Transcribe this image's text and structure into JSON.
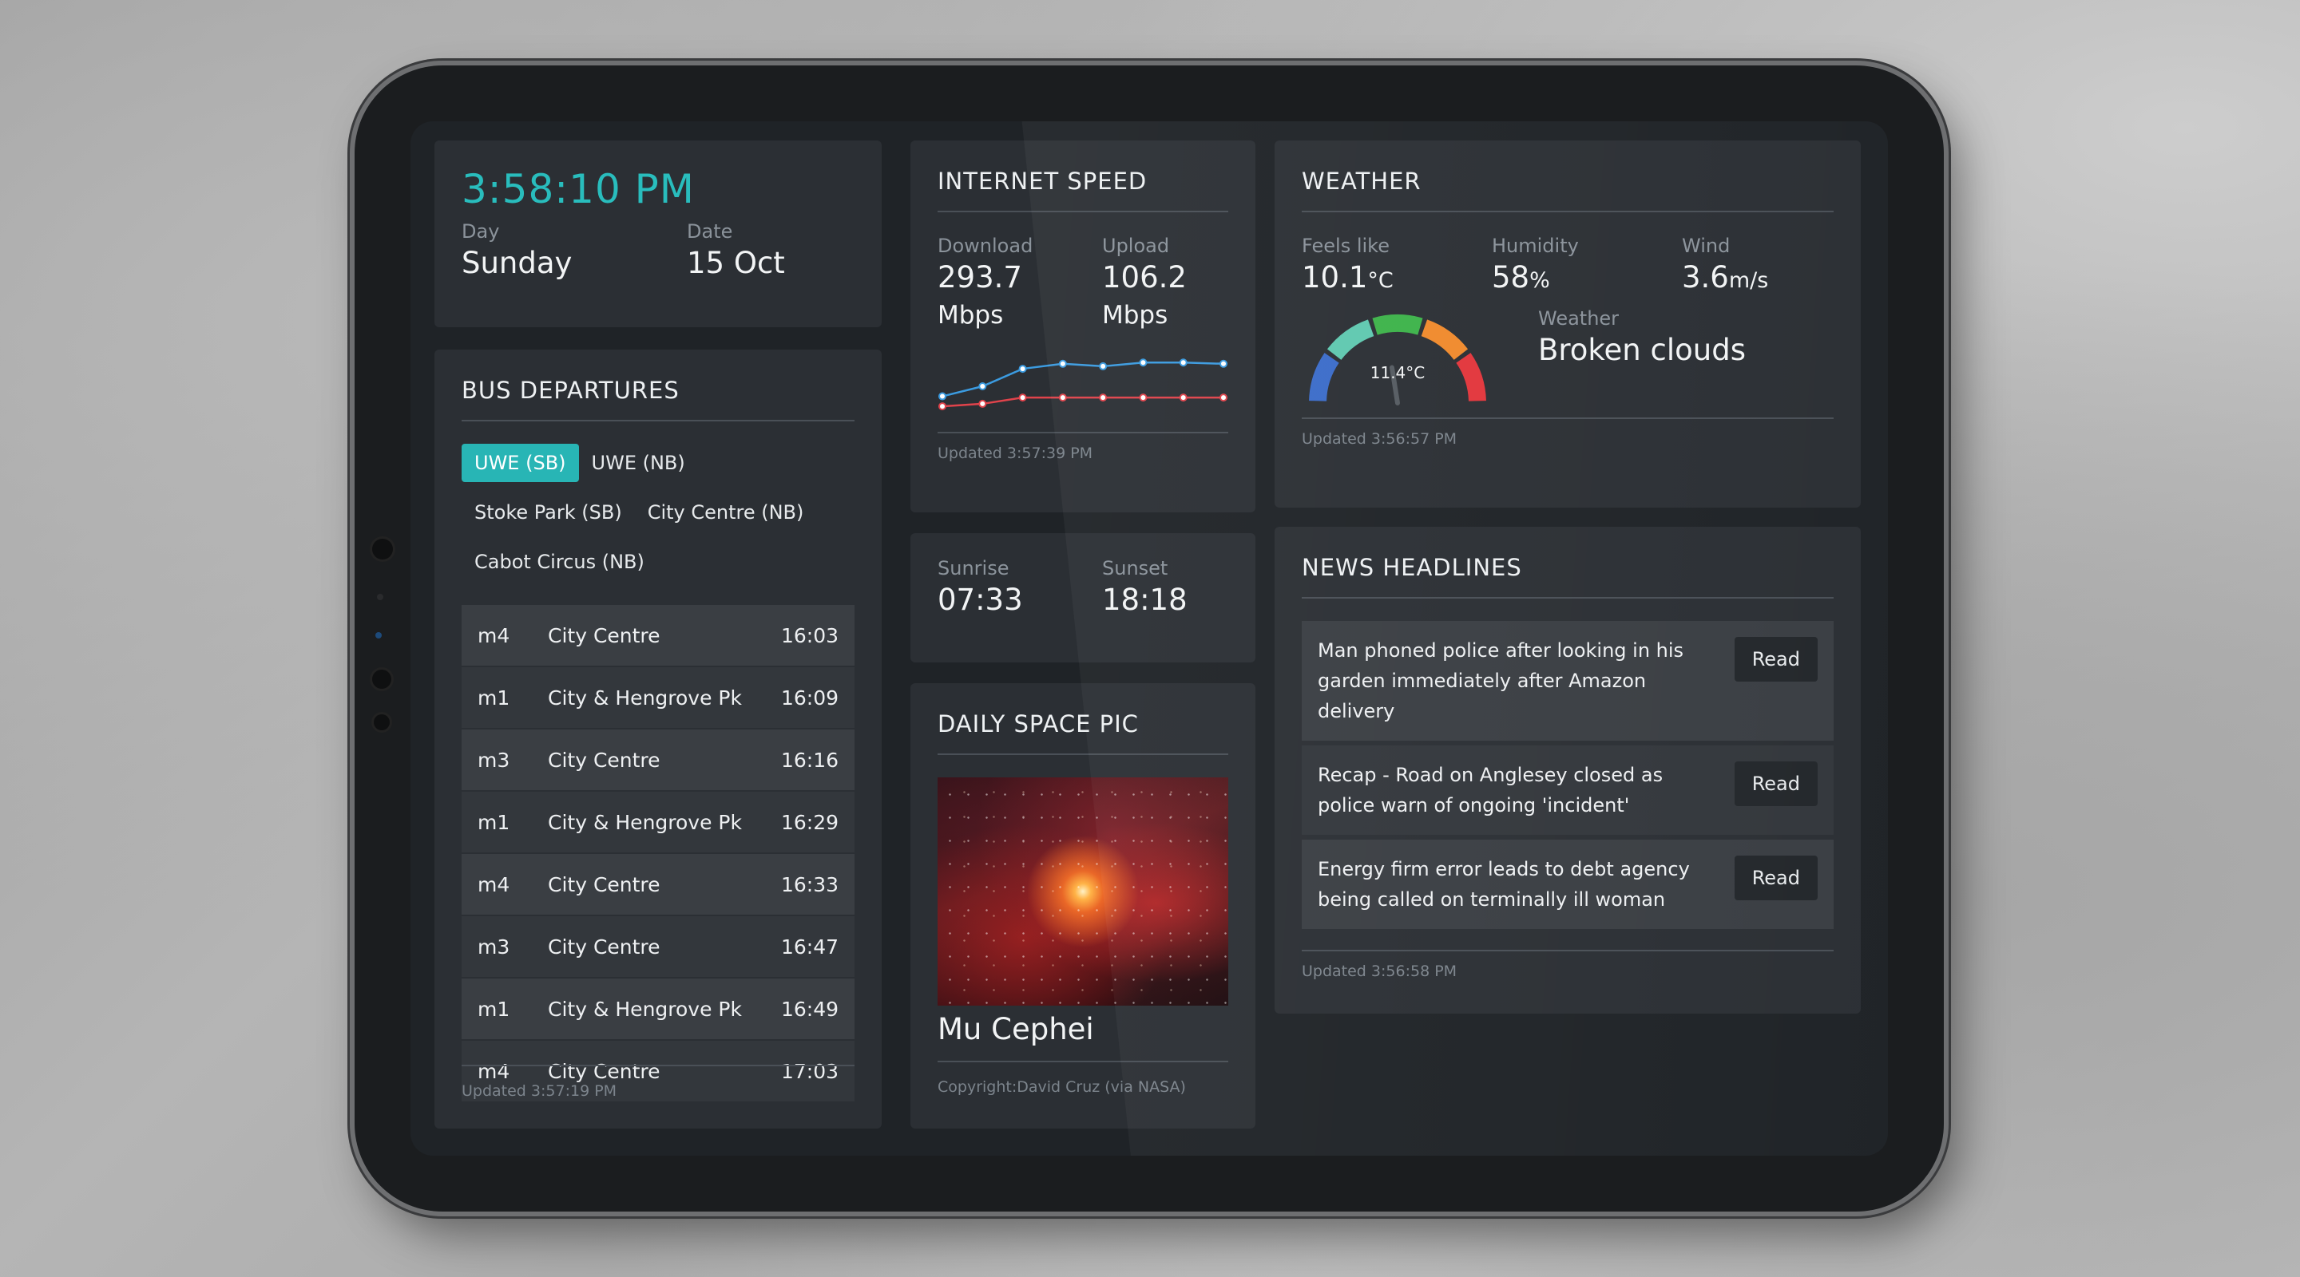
{
  "clock": {
    "time": "3:58:10 PM",
    "day_label": "Day",
    "day": "Sunday",
    "date_label": "Date",
    "date": "15 Oct"
  },
  "internet": {
    "title": "INTERNET SPEED",
    "download_label": "Download",
    "download_value": "293.7",
    "download_unit": "Mbps",
    "upload_label": "Upload",
    "upload_value": "106.2",
    "upload_unit": "Mbps",
    "updated": "Updated 3:57:39 PM",
    "chart_data": {
      "type": "line",
      "x": [
        1,
        2,
        3,
        4,
        5,
        6,
        7,
        8
      ],
      "series": [
        {
          "values": [
            62,
            70,
            84,
            88,
            86,
            89,
            89,
            88
          ],
          "color": "#3b9be0"
        },
        {
          "values": [
            54,
            56,
            61,
            61,
            61,
            61,
            61,
            61
          ],
          "color": "#e0434b"
        }
      ],
      "ylim": [
        40,
        100
      ]
    }
  },
  "weather": {
    "title": "WEATHER",
    "feels_label": "Feels like",
    "feels_value": "10.1",
    "feels_unit": "°C",
    "humidity_label": "Humidity",
    "humidity_value": "58",
    "humidity_unit": "%",
    "wind_label": "Wind",
    "wind_value": "3.6",
    "wind_unit": "m/s",
    "gauge_value": "11.4°C",
    "gauge_fraction": 0.45,
    "gauge_colors": [
      "#3b6cc9",
      "#5fc8b0",
      "#3db34a",
      "#f08a2c",
      "#e2363c"
    ],
    "condition_label": "Weather",
    "condition": "Broken clouds",
    "updated": "Updated 3:56:57 PM"
  },
  "bus": {
    "title": "BUS DEPARTURES",
    "tabs": [
      "UWE (SB)",
      "UWE (NB)",
      "Stoke Park (SB)",
      "City Centre (NB)",
      "Cabot Circus (NB)"
    ],
    "active_tab": "UWE (SB)",
    "rows": [
      {
        "route": "m4",
        "dest": "City Centre",
        "time": "16:03"
      },
      {
        "route": "m1",
        "dest": "City & Hengrove Pk",
        "time": "16:09"
      },
      {
        "route": "m3",
        "dest": "City Centre",
        "time": "16:16"
      },
      {
        "route": "m1",
        "dest": "City & Hengrove Pk",
        "time": "16:29"
      },
      {
        "route": "m4",
        "dest": "City Centre",
        "time": "16:33"
      },
      {
        "route": "m3",
        "dest": "City Centre",
        "time": "16:47"
      },
      {
        "route": "m1",
        "dest": "City & Hengrove Pk",
        "time": "16:49"
      },
      {
        "route": "m4",
        "dest": "City Centre",
        "time": "17:03"
      }
    ],
    "updated": "Updated 3:57:19 PM"
  },
  "sun": {
    "sunrise_label": "Sunrise",
    "sunrise": "07:33",
    "sunset_label": "Sunset",
    "sunset": "18:18"
  },
  "space": {
    "title": "DAILY SPACE PIC",
    "name": "Mu Cephei",
    "copyright": "Copyright:David Cruz (via NASA)"
  },
  "news": {
    "title": "NEWS HEADLINES",
    "items": [
      {
        "text": "Man phoned police after looking in his garden immediately after Amazon delivery",
        "button": "Read"
      },
      {
        "text": "Recap - Road on Anglesey closed as police warn of ongoing 'incident'",
        "button": "Read"
      },
      {
        "text": "Energy firm error leads to debt agency being called on terminally ill woman",
        "button": "Read"
      }
    ],
    "updated": "Updated 3:56:58 PM"
  }
}
